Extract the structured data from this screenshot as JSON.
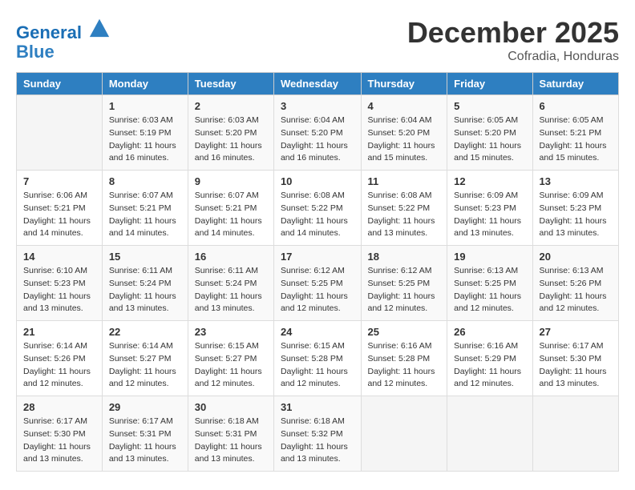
{
  "header": {
    "logo_line1": "General",
    "logo_line2": "Blue",
    "month_title": "December 2025",
    "subtitle": "Cofradia, Honduras"
  },
  "days_of_week": [
    "Sunday",
    "Monday",
    "Tuesday",
    "Wednesday",
    "Thursday",
    "Friday",
    "Saturday"
  ],
  "weeks": [
    [
      {
        "num": "",
        "sunrise": "",
        "sunset": "",
        "daylight": ""
      },
      {
        "num": "1",
        "sunrise": "Sunrise: 6:03 AM",
        "sunset": "Sunset: 5:19 PM",
        "daylight": "Daylight: 11 hours and 16 minutes."
      },
      {
        "num": "2",
        "sunrise": "Sunrise: 6:03 AM",
        "sunset": "Sunset: 5:20 PM",
        "daylight": "Daylight: 11 hours and 16 minutes."
      },
      {
        "num": "3",
        "sunrise": "Sunrise: 6:04 AM",
        "sunset": "Sunset: 5:20 PM",
        "daylight": "Daylight: 11 hours and 16 minutes."
      },
      {
        "num": "4",
        "sunrise": "Sunrise: 6:04 AM",
        "sunset": "Sunset: 5:20 PM",
        "daylight": "Daylight: 11 hours and 15 minutes."
      },
      {
        "num": "5",
        "sunrise": "Sunrise: 6:05 AM",
        "sunset": "Sunset: 5:20 PM",
        "daylight": "Daylight: 11 hours and 15 minutes."
      },
      {
        "num": "6",
        "sunrise": "Sunrise: 6:05 AM",
        "sunset": "Sunset: 5:21 PM",
        "daylight": "Daylight: 11 hours and 15 minutes."
      }
    ],
    [
      {
        "num": "7",
        "sunrise": "Sunrise: 6:06 AM",
        "sunset": "Sunset: 5:21 PM",
        "daylight": "Daylight: 11 hours and 14 minutes."
      },
      {
        "num": "8",
        "sunrise": "Sunrise: 6:07 AM",
        "sunset": "Sunset: 5:21 PM",
        "daylight": "Daylight: 11 hours and 14 minutes."
      },
      {
        "num": "9",
        "sunrise": "Sunrise: 6:07 AM",
        "sunset": "Sunset: 5:21 PM",
        "daylight": "Daylight: 11 hours and 14 minutes."
      },
      {
        "num": "10",
        "sunrise": "Sunrise: 6:08 AM",
        "sunset": "Sunset: 5:22 PM",
        "daylight": "Daylight: 11 hours and 14 minutes."
      },
      {
        "num": "11",
        "sunrise": "Sunrise: 6:08 AM",
        "sunset": "Sunset: 5:22 PM",
        "daylight": "Daylight: 11 hours and 13 minutes."
      },
      {
        "num": "12",
        "sunrise": "Sunrise: 6:09 AM",
        "sunset": "Sunset: 5:23 PM",
        "daylight": "Daylight: 11 hours and 13 minutes."
      },
      {
        "num": "13",
        "sunrise": "Sunrise: 6:09 AM",
        "sunset": "Sunset: 5:23 PM",
        "daylight": "Daylight: 11 hours and 13 minutes."
      }
    ],
    [
      {
        "num": "14",
        "sunrise": "Sunrise: 6:10 AM",
        "sunset": "Sunset: 5:23 PM",
        "daylight": "Daylight: 11 hours and 13 minutes."
      },
      {
        "num": "15",
        "sunrise": "Sunrise: 6:11 AM",
        "sunset": "Sunset: 5:24 PM",
        "daylight": "Daylight: 11 hours and 13 minutes."
      },
      {
        "num": "16",
        "sunrise": "Sunrise: 6:11 AM",
        "sunset": "Sunset: 5:24 PM",
        "daylight": "Daylight: 11 hours and 13 minutes."
      },
      {
        "num": "17",
        "sunrise": "Sunrise: 6:12 AM",
        "sunset": "Sunset: 5:25 PM",
        "daylight": "Daylight: 11 hours and 12 minutes."
      },
      {
        "num": "18",
        "sunrise": "Sunrise: 6:12 AM",
        "sunset": "Sunset: 5:25 PM",
        "daylight": "Daylight: 11 hours and 12 minutes."
      },
      {
        "num": "19",
        "sunrise": "Sunrise: 6:13 AM",
        "sunset": "Sunset: 5:25 PM",
        "daylight": "Daylight: 11 hours and 12 minutes."
      },
      {
        "num": "20",
        "sunrise": "Sunrise: 6:13 AM",
        "sunset": "Sunset: 5:26 PM",
        "daylight": "Daylight: 11 hours and 12 minutes."
      }
    ],
    [
      {
        "num": "21",
        "sunrise": "Sunrise: 6:14 AM",
        "sunset": "Sunset: 5:26 PM",
        "daylight": "Daylight: 11 hours and 12 minutes."
      },
      {
        "num": "22",
        "sunrise": "Sunrise: 6:14 AM",
        "sunset": "Sunset: 5:27 PM",
        "daylight": "Daylight: 11 hours and 12 minutes."
      },
      {
        "num": "23",
        "sunrise": "Sunrise: 6:15 AM",
        "sunset": "Sunset: 5:27 PM",
        "daylight": "Daylight: 11 hours and 12 minutes."
      },
      {
        "num": "24",
        "sunrise": "Sunrise: 6:15 AM",
        "sunset": "Sunset: 5:28 PM",
        "daylight": "Daylight: 11 hours and 12 minutes."
      },
      {
        "num": "25",
        "sunrise": "Sunrise: 6:16 AM",
        "sunset": "Sunset: 5:28 PM",
        "daylight": "Daylight: 11 hours and 12 minutes."
      },
      {
        "num": "26",
        "sunrise": "Sunrise: 6:16 AM",
        "sunset": "Sunset: 5:29 PM",
        "daylight": "Daylight: 11 hours and 12 minutes."
      },
      {
        "num": "27",
        "sunrise": "Sunrise: 6:17 AM",
        "sunset": "Sunset: 5:30 PM",
        "daylight": "Daylight: 11 hours and 13 minutes."
      }
    ],
    [
      {
        "num": "28",
        "sunrise": "Sunrise: 6:17 AM",
        "sunset": "Sunset: 5:30 PM",
        "daylight": "Daylight: 11 hours and 13 minutes."
      },
      {
        "num": "29",
        "sunrise": "Sunrise: 6:17 AM",
        "sunset": "Sunset: 5:31 PM",
        "daylight": "Daylight: 11 hours and 13 minutes."
      },
      {
        "num": "30",
        "sunrise": "Sunrise: 6:18 AM",
        "sunset": "Sunset: 5:31 PM",
        "daylight": "Daylight: 11 hours and 13 minutes."
      },
      {
        "num": "31",
        "sunrise": "Sunrise: 6:18 AM",
        "sunset": "Sunset: 5:32 PM",
        "daylight": "Daylight: 11 hours and 13 minutes."
      },
      {
        "num": "",
        "sunrise": "",
        "sunset": "",
        "daylight": ""
      },
      {
        "num": "",
        "sunrise": "",
        "sunset": "",
        "daylight": ""
      },
      {
        "num": "",
        "sunrise": "",
        "sunset": "",
        "daylight": ""
      }
    ]
  ]
}
